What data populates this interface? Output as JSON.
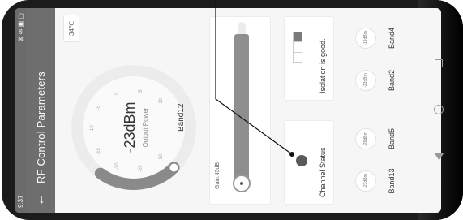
{
  "status_bar": {
    "time": "9:37",
    "icons": "⊠ ✉ ▣ ▢"
  },
  "app_bar": {
    "back_icon": "arrow-back-icon",
    "title": "RF Control Parameters"
  },
  "temperature": "34℃",
  "gauge": {
    "value": "-23dBm",
    "label": "Output Power",
    "ticks": [
      "-30",
      "-25",
      "-20",
      "-15",
      "-10",
      "-5",
      "0",
      "5",
      "10"
    ],
    "fill_fraction": 0.3
  },
  "band_title": "Band12",
  "gain": {
    "label": "Gain:45dB",
    "fill_fraction": 0.93
  },
  "channel_status": {
    "label": "Channel Status",
    "icon": "microphone-icon"
  },
  "isolation": {
    "label": "Isolation is good."
  },
  "bands": [
    {
      "name": "Band13",
      "value": "-23dBm"
    },
    {
      "name": "Band5",
      "value": "-26dBm"
    },
    {
      "name": "Band2",
      "value": "-23dBm"
    },
    {
      "name": "Band4",
      "value": "-19dBm"
    }
  ],
  "nav": {
    "recent": "square-icon",
    "home": "circle-icon",
    "back": "triangle-back-icon"
  }
}
